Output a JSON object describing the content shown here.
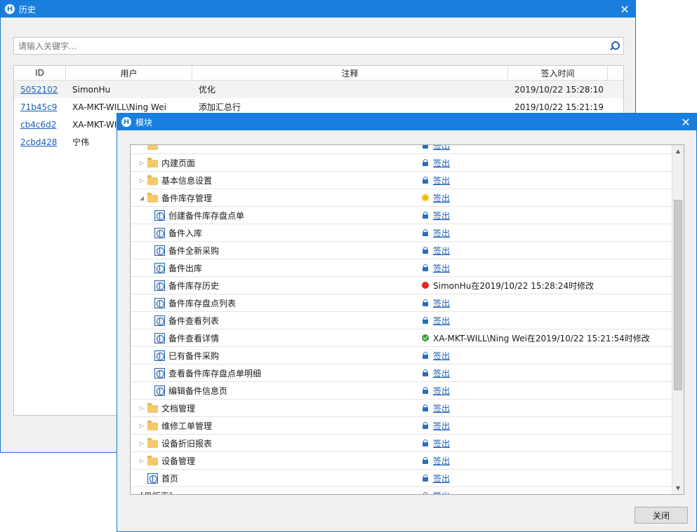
{
  "history": {
    "title": "历史",
    "search_placeholder": "请输入关键字...",
    "columns": [
      "ID",
      "用户",
      "注释",
      "签入时间"
    ],
    "rows": [
      {
        "id": "5052102",
        "user": "SimonHu",
        "note": "优化",
        "time": "2019/10/22 15:28:10"
      },
      {
        "id": "71b45c9",
        "user": "XA-MKT-WILL\\Ning Wei",
        "note": "添加汇总行",
        "time": "2019/10/22 15:21:19"
      },
      {
        "id": "cb4c6d2",
        "user": "XA-MKT-WI",
        "note": "",
        "time": ""
      },
      {
        "id": "2cbd428",
        "user": "宁伟",
        "note": "",
        "time": ""
      }
    ]
  },
  "module": {
    "title": "模块",
    "close_button": "关闭",
    "rows": [
      {
        "label": "",
        "type": "folder",
        "level": 0,
        "expander": "",
        "status": "lock",
        "status_text": "签出"
      },
      {
        "label": "内建页面",
        "type": "folder",
        "level": 0,
        "expander": "collapsed",
        "status": "lock",
        "status_text": "签出"
      },
      {
        "label": "基本信息设置",
        "type": "folder",
        "level": 0,
        "expander": "collapsed",
        "status": "lock",
        "status_text": "签出"
      },
      {
        "label": "备件库存管理",
        "type": "folder",
        "level": 0,
        "expander": "expanded",
        "status": "sun",
        "status_text": "签出"
      },
      {
        "label": "创建备件库存盘点单",
        "type": "page",
        "level": 1,
        "expander": "",
        "status": "lock",
        "status_text": "签出"
      },
      {
        "label": "备件入库",
        "type": "page",
        "level": 1,
        "expander": "",
        "status": "lock",
        "status_text": "签出"
      },
      {
        "label": "备件全新采购",
        "type": "page",
        "level": 1,
        "expander": "",
        "status": "lock",
        "status_text": "签出"
      },
      {
        "label": "备件出库",
        "type": "page",
        "level": 1,
        "expander": "",
        "status": "lock",
        "status_text": "签出"
      },
      {
        "label": "备件库存历史",
        "type": "page",
        "level": 1,
        "expander": "",
        "status": "red",
        "status_text": "SimonHu在2019/10/22 15:28:24时修改"
      },
      {
        "label": "备件库存盘点列表",
        "type": "page",
        "level": 1,
        "expander": "",
        "status": "lock",
        "status_text": "签出"
      },
      {
        "label": "备件查看列表",
        "type": "page",
        "level": 1,
        "expander": "",
        "status": "lock",
        "status_text": "签出"
      },
      {
        "label": "备件查看详情",
        "type": "page",
        "level": 1,
        "expander": "",
        "status": "green",
        "status_text": "XA-MKT-WILL\\Ning Wei在2019/10/22 15:21:54时修改"
      },
      {
        "label": "已有备件采购",
        "type": "page",
        "level": 1,
        "expander": "",
        "status": "lock",
        "status_text": "签出"
      },
      {
        "label": "查看备件库存盘点单明细",
        "type": "page",
        "level": 1,
        "expander": "",
        "status": "lock",
        "status_text": "签出"
      },
      {
        "label": "编辑备件信息页",
        "type": "page",
        "level": 1,
        "expander": "",
        "status": "lock",
        "status_text": "签出"
      },
      {
        "label": "文档管理",
        "type": "folder",
        "level": 0,
        "expander": "collapsed",
        "status": "lock",
        "status_text": "签出"
      },
      {
        "label": "维修工单管理",
        "type": "folder",
        "level": 0,
        "expander": "collapsed",
        "status": "lock",
        "status_text": "签出"
      },
      {
        "label": "设备折旧报表",
        "type": "folder",
        "level": 0,
        "expander": "collapsed",
        "status": "lock",
        "status_text": "签出"
      },
      {
        "label": "设备管理",
        "type": "folder",
        "level": 0,
        "expander": "collapsed",
        "status": "lock",
        "status_text": "签出"
      },
      {
        "label": "首页",
        "type": "page",
        "level": 0,
        "expander": "",
        "status": "lock",
        "status_text": "签出"
      },
      {
        "label": "[母版页]",
        "type": "none",
        "level": -1,
        "expander": "expanded",
        "status": "lock",
        "status_text": "签出"
      }
    ]
  },
  "colors": {
    "accent": "#1a7fdc",
    "link": "#1a5fb4"
  }
}
